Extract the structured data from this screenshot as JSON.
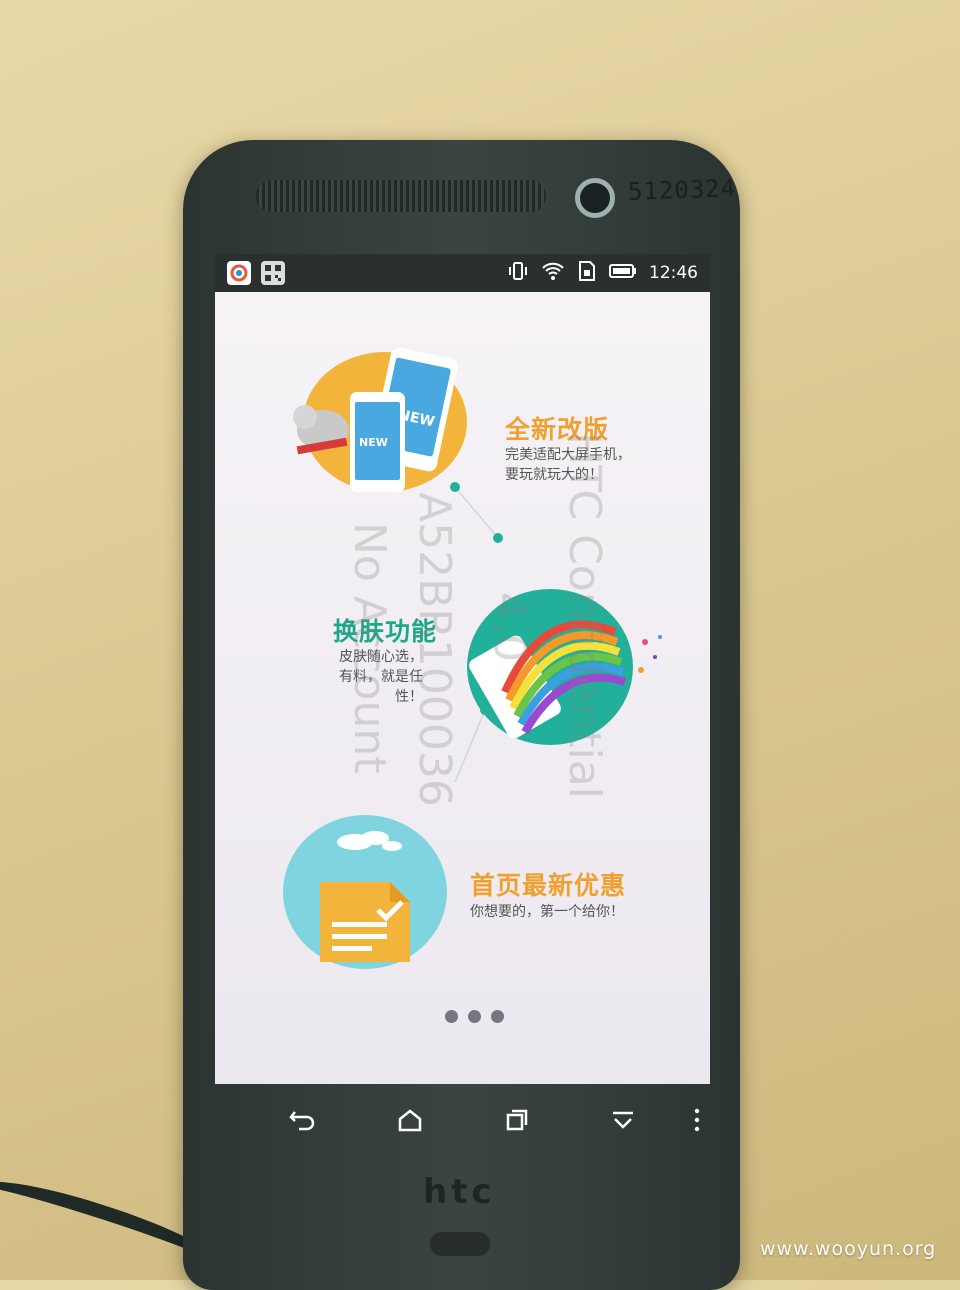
{
  "status_bar": {
    "time": "12:46",
    "left_icons": [
      "app-notification-icon",
      "qr-code-icon"
    ],
    "right_icons": [
      "vibrate-icon",
      "wifi-icon",
      "sim-icon",
      "battery-icon"
    ]
  },
  "device": {
    "brand_logo": "htc",
    "id_label": "5120324"
  },
  "features": [
    {
      "title": "全新改版",
      "desc_lines": [
        "完美适配大屏手机，",
        "要玩就玩大的！"
      ],
      "color": "#f0a030",
      "phone_label": "NEW"
    },
    {
      "title": "换肤功能",
      "desc_lines": [
        "皮肤随心选，",
        "有料，就是任性！"
      ],
      "color": "#1fa888"
    },
    {
      "title": "首页最新优惠",
      "desc_lines": [
        "你想要的，第一个给你！"
      ],
      "color": "#f0a030"
    }
  ],
  "pagination": {
    "count": 3,
    "active": 3
  },
  "watermarks": [
    "HTC Confidential",
    "4.0",
    "A52BR100036",
    "No Account"
  ],
  "navigation": [
    "back-icon",
    "home-icon",
    "recents-icon",
    "hide-icon",
    "menu-icon"
  ],
  "footer_watermark": "www.wooyun.org",
  "colors": {
    "accent_orange": "#f0a030",
    "accent_teal": "#1fa888",
    "circle_yellow": "#f3b43c",
    "circle_teal": "#22b09a",
    "circle_cyan": "#7fd4e0"
  }
}
